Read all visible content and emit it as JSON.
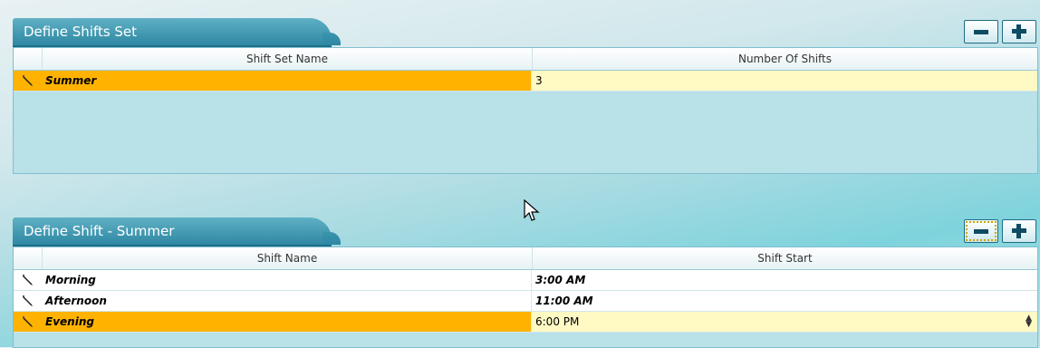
{
  "shifts_set_panel": {
    "title": "Define Shifts Set",
    "columns": [
      "Shift Set Name",
      "Number Of Shifts"
    ],
    "rows": [
      {
        "name": "Summer",
        "count": "3"
      }
    ]
  },
  "shift_panel": {
    "title": "Define Shift - Summer",
    "columns": [
      "Shift Name",
      "Shift Start"
    ],
    "rows": [
      {
        "name": "Morning",
        "start": "3:00 AM"
      },
      {
        "name": "Afternoon",
        "start": "11:00 AM"
      },
      {
        "name": "Evening",
        "start": "6:00 PM"
      }
    ]
  },
  "icons": {
    "remove": "minus-icon",
    "add": "plus-icon",
    "edit": "pencil-icon",
    "spinner": "spinner-updown-icon"
  },
  "colors": {
    "tab": "#2f88a3",
    "selected_row": "#ffb300",
    "selected_value_cell": "#fff9c4",
    "button_glyph": "#0f4c61"
  }
}
